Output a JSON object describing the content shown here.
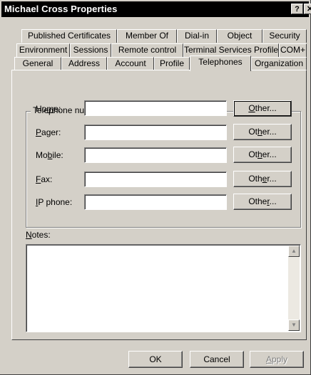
{
  "window": {
    "title": "Michael Cross Properties",
    "help_glyph": "?",
    "close_glyph": "✕"
  },
  "tabs": {
    "row1": [
      "Published Certificates",
      "Member Of",
      "Dial-in",
      "Object",
      "Security"
    ],
    "row2": [
      "Environment",
      "Sessions",
      "Remote control",
      "Terminal Services Profile",
      "COM+"
    ],
    "row3": [
      "General",
      "Address",
      "Account",
      "Profile",
      "Telephones",
      "Organization"
    ],
    "active": "Telephones"
  },
  "telephones": {
    "group_label": "Telephone numbers",
    "rows": [
      {
        "pre": "Ho",
        "ul": "m",
        "post": "e:",
        "value": "",
        "btn_pre": "",
        "btn_ul": "O",
        "btn_post": "ther..."
      },
      {
        "pre": "",
        "ul": "P",
        "post": "ager:",
        "value": "",
        "btn_pre": "Ot",
        "btn_ul": "h",
        "btn_post": "er..."
      },
      {
        "pre": "Mo",
        "ul": "b",
        "post": "ile:",
        "value": "",
        "btn_pre": "Ot",
        "btn_ul": "h",
        "btn_post": "er..."
      },
      {
        "pre": "",
        "ul": "F",
        "post": "ax:",
        "value": "",
        "btn_pre": "Oth",
        "btn_ul": "e",
        "btn_post": "r..."
      },
      {
        "pre": "",
        "ul": "I",
        "post": "P phone:",
        "value": "",
        "btn_pre": "Othe",
        "btn_ul": "r",
        "btn_post": "..."
      }
    ],
    "notes_label_ul": "N",
    "notes_label_rest": "otes:",
    "notes_value": ""
  },
  "buttons": {
    "ok": "OK",
    "cancel": "Cancel",
    "apply_ul": "A",
    "apply_rest": "pply"
  },
  "icons": {
    "scroll_up": "▲",
    "scroll_down": "▼"
  }
}
